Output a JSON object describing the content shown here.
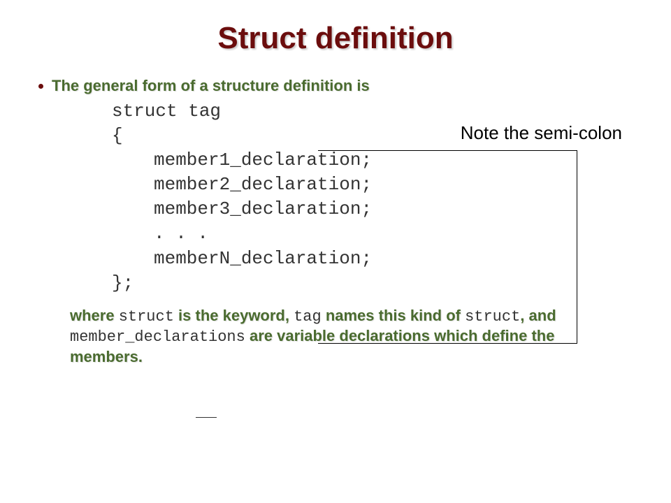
{
  "title": "Struct definition",
  "bullet": "The general form of a structure definition is",
  "code": {
    "l1": "struct tag",
    "l2": "{",
    "l3": "member1_declaration;",
    "l4": "member2_declaration;",
    "l5": "member3_declaration;",
    "l6": ". . .",
    "l7": "memberN_declaration;",
    "l8": "};"
  },
  "note": "Note the semi-colon",
  "desc": {
    "p1": "where ",
    "m1": "struct",
    "p2": " is the keyword, ",
    "m2": "tag",
    "p3": " names this kind of ",
    "m3": "struct",
    "p4": ", and ",
    "m4": "member_declarations",
    "p5": " are variable declarations which define the members."
  }
}
